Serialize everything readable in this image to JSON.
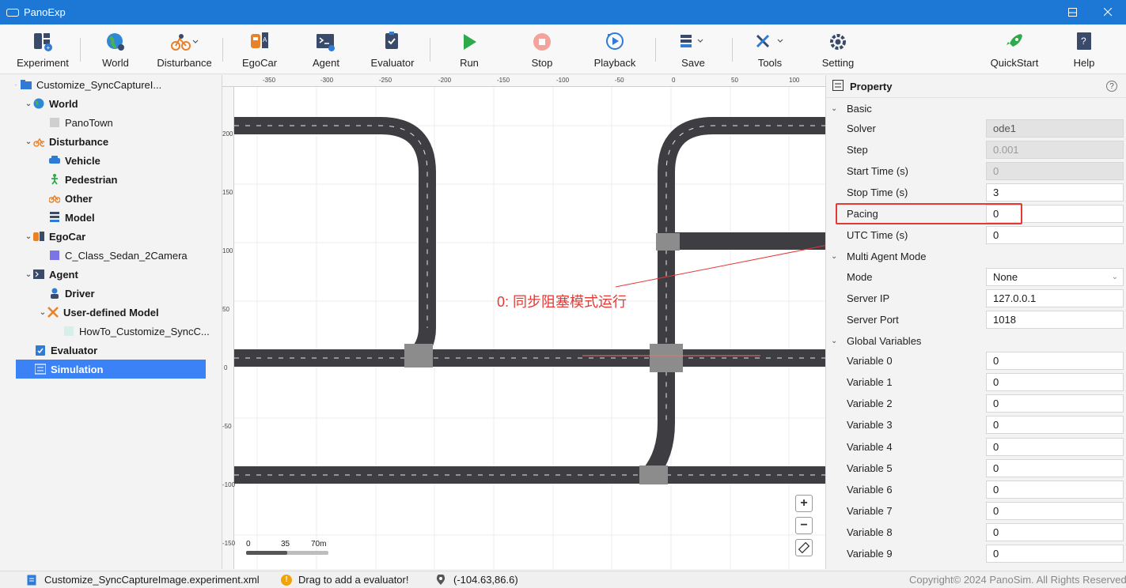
{
  "window": {
    "title": "PanoExp"
  },
  "toolbar": [
    {
      "label": "Experiment",
      "icon": "experiment-icon"
    },
    {
      "label": "World",
      "icon": "world-globe-icon"
    },
    {
      "label": "Disturbance",
      "icon": "disturbance-icon"
    },
    {
      "label": "EgoCar",
      "icon": "egocar-icon"
    },
    {
      "label": "Agent",
      "icon": "agent-icon"
    },
    {
      "label": "Evaluator",
      "icon": "evaluator-icon"
    },
    {
      "label": "Run",
      "icon": "run-play-icon"
    },
    {
      "label": "Stop",
      "icon": "stop-icon"
    },
    {
      "label": "Playback",
      "icon": "playback-icon"
    },
    {
      "label": "Save",
      "icon": "save-icon"
    },
    {
      "label": "Tools",
      "icon": "tools-icon"
    },
    {
      "label": "Setting",
      "icon": "gear-icon"
    },
    {
      "label": "QuickStart",
      "icon": "rocket-icon"
    },
    {
      "label": "Help",
      "icon": "help-book-icon"
    }
  ],
  "tree": {
    "root": "Customize_SyncCaptureI...",
    "world": "World",
    "world_child": "PanoTown",
    "disturbance": "Disturbance",
    "vehicle": "Vehicle",
    "pedestrian": "Pedestrian",
    "other": "Other",
    "model": "Model",
    "egocar": "EgoCar",
    "egocar_child": "C_Class_Sedan_2Camera",
    "agent": "Agent",
    "driver": "Driver",
    "user_model": "User-defined Model",
    "user_model_child": "HowTo_Customize_SyncC...",
    "evaluator": "Evaluator",
    "simulation": "Simulation"
  },
  "canvas": {
    "ruler_x": [
      "-350",
      "-300",
      "-250",
      "-200",
      "-150",
      "-100",
      "-50",
      "0",
      "50",
      "100"
    ],
    "ruler_y": [
      "200",
      "150",
      "100",
      "50",
      "0",
      "-50",
      "-100",
      "-150"
    ],
    "annotation": "0: 同步阻塞模式运行",
    "scale": {
      "s0": "0",
      "s1": "35",
      "s2": "70m"
    },
    "zoom_in": "+",
    "zoom_out": "−"
  },
  "property": {
    "title": "Property",
    "help": "?",
    "basic": {
      "label": "Basic",
      "solver_label": "Solver",
      "solver": "ode1",
      "step_label": "Step",
      "step": "0.001",
      "start_label": "Start Time (s)",
      "start": "0",
      "stop_label": "Stop Time (s)",
      "stop": "3",
      "pacing_label": "Pacing",
      "pacing": "0",
      "utc_label": "UTC Time (s)",
      "utc": "0"
    },
    "multi": {
      "label": "Multi Agent Mode",
      "mode_label": "Mode",
      "mode": "None",
      "ip_label": "Server IP",
      "ip": "127.0.0.1",
      "port_label": "Server Port",
      "port": "1018"
    },
    "globals": {
      "label": "Global Variables",
      "vars": [
        {
          "name": "Variable 0",
          "value": "0"
        },
        {
          "name": "Variable 1",
          "value": "0"
        },
        {
          "name": "Variable 2",
          "value": "0"
        },
        {
          "name": "Variable 3",
          "value": "0"
        },
        {
          "name": "Variable 4",
          "value": "0"
        },
        {
          "name": "Variable 5",
          "value": "0"
        },
        {
          "name": "Variable 6",
          "value": "0"
        },
        {
          "name": "Variable 7",
          "value": "0"
        },
        {
          "name": "Variable 8",
          "value": "0"
        },
        {
          "name": "Variable 9",
          "value": "0"
        }
      ]
    }
  },
  "status": {
    "file": "Customize_SyncCaptureImage.experiment.xml",
    "warning": "Drag to add a evaluator!",
    "coords": "(-104.63,86.6)",
    "copyright": "Copyright© 2024 PanoSim. All Rights Reserved"
  },
  "colors": {
    "titlebar": "#1d77d4",
    "selection": "#3b82f6",
    "annotation": "#e53935",
    "road": "#3d3d42"
  }
}
